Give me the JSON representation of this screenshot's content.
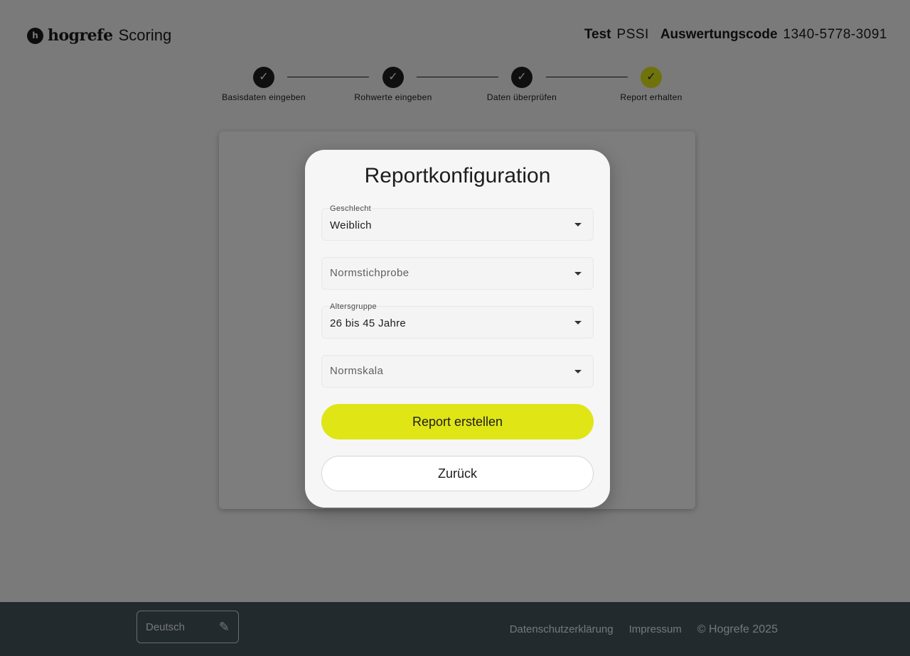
{
  "header": {
    "brand": "hogrefe",
    "product": "Scoring",
    "logo_mark": "h",
    "test_label": "Test",
    "test_value": "PSSI",
    "code_label": "Auswertungscode",
    "code_value": "1340-5778-3091"
  },
  "stepper": {
    "steps": [
      {
        "label": "Basisdaten eingeben",
        "icon": "check-icon",
        "glyph": "✓",
        "state": "done"
      },
      {
        "label": "Rohwerte eingeben",
        "icon": "check-icon",
        "glyph": "✓",
        "state": "done"
      },
      {
        "label": "Daten überprüfen",
        "icon": "check-icon",
        "glyph": "✓",
        "state": "done"
      },
      {
        "label": "Report erhalten",
        "icon": "check-icon",
        "glyph": "✓",
        "state": "active"
      }
    ]
  },
  "modal": {
    "title": "Reportkonfiguration",
    "fields": [
      {
        "label": "Geschlecht",
        "value": "Weiblich",
        "placeholder": ""
      },
      {
        "label": "",
        "value": "",
        "placeholder": "Normstichprobe"
      },
      {
        "label": "Altersgruppe",
        "value": "26 bis 45 Jahre",
        "placeholder": ""
      },
      {
        "label": "",
        "value": "",
        "placeholder": "Normskala"
      }
    ],
    "primary_button": "Report erstellen",
    "secondary_button": "Zurück"
  },
  "footer": {
    "language": "Deutsch",
    "language_icon": "pencil-icon",
    "links": [
      "Datenschutzerklärung",
      "Impressum"
    ],
    "copyright": "© Hogrefe 2025"
  },
  "colors": {
    "accent": "#e0e516",
    "footer_bg": "#46555d",
    "scrim": "rgba(0,0,0,0.5)"
  }
}
